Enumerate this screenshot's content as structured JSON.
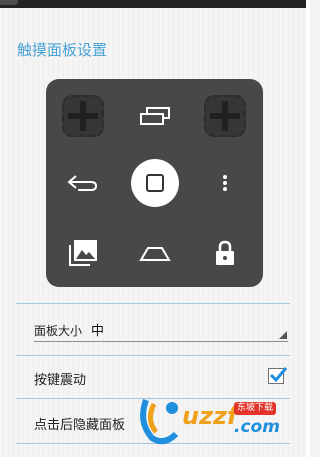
{
  "screen": {
    "title": "触摸面板设置"
  },
  "panel": {
    "icons": [
      "add-slot-icon",
      "recent-apps-icon",
      "add-slot-icon",
      "back-icon",
      "home-icon",
      "more-icon",
      "gallery-icon",
      "home-outline-icon",
      "lock-icon"
    ]
  },
  "settings": {
    "panel_size_label": "面板大小",
    "panel_size_value": "中",
    "vibration_label": "按键震动",
    "vibration_checked": true,
    "hide_after_click_label": "点击后隐藏面板"
  },
  "watermark": {
    "brand": "uzzf",
    "domain": ".com",
    "badge": "东坡下载"
  },
  "colors": {
    "accent": "#4aa3d6",
    "panel": "#484848",
    "check": "#1f8fde"
  }
}
